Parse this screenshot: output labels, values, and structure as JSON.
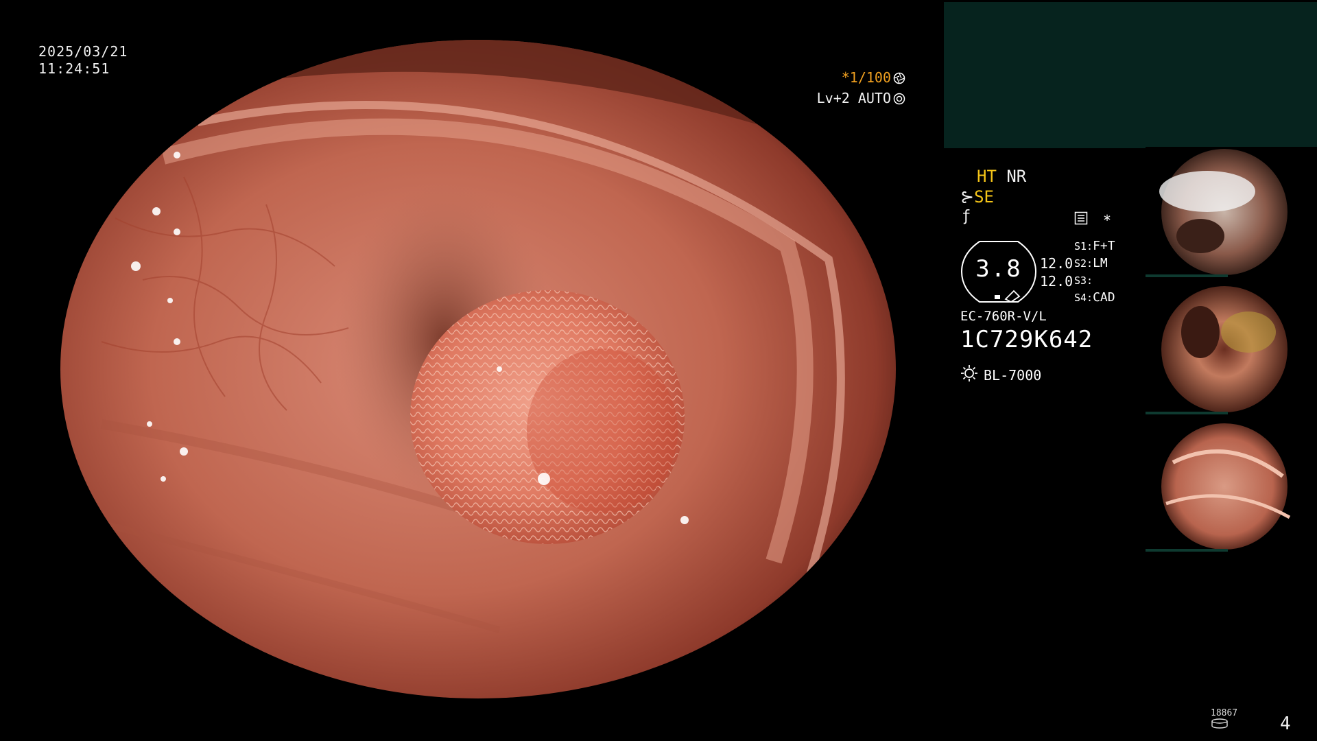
{
  "overlay": {
    "date": "2025/03/21",
    "time": "11:24:51",
    "shutter": "*1/100",
    "enhance": "Lv+2 AUTO"
  },
  "status": {
    "ht": "HT",
    "nr": "NR",
    "se": "SE",
    "asterisk": "*"
  },
  "gauge": {
    "value": "3.8",
    "upper": "12.0",
    "lower": "12.0"
  },
  "switches": [
    {
      "label": "S1:",
      "value": "F+T"
    },
    {
      "label": "S2:",
      "value": "LM"
    },
    {
      "label": "S3:",
      "value": ""
    },
    {
      "label": "S4:",
      "value": "CAD"
    }
  ],
  "scope": {
    "model": "EC-760R-V/L",
    "serial": "1C729K642",
    "light_source": "BL-7000"
  },
  "footer": {
    "counter": "18867",
    "page": "4"
  },
  "icons": {
    "shutter": "aperture-icon",
    "enhance": "gear-icon",
    "light": "sun-icon",
    "memory": "memory-icon",
    "scope": "scope-icon"
  },
  "colors": {
    "panel": "#06231e",
    "accent_orange": "#f0a020",
    "accent_yellow": "#f5c518",
    "mucosa": "#c86a55"
  }
}
